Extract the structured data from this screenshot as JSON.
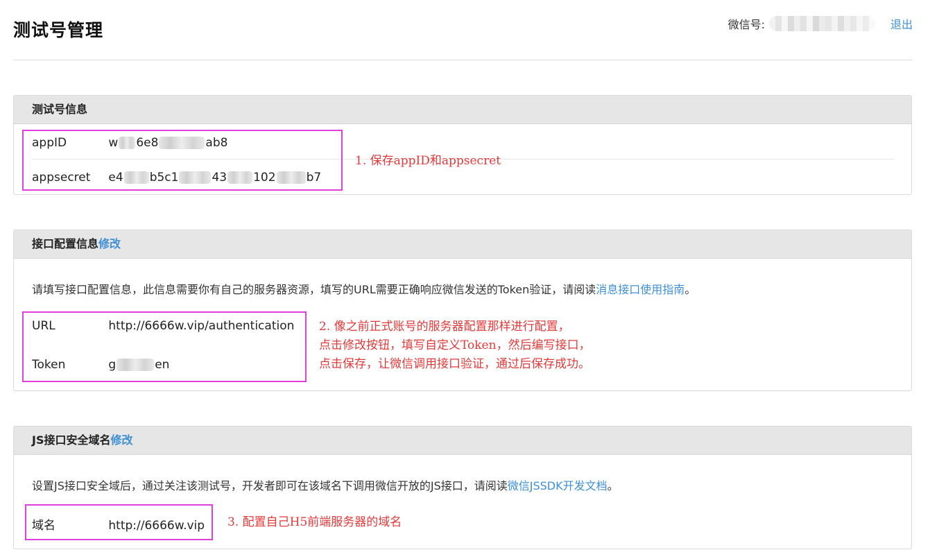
{
  "header": {
    "title": "测试号管理",
    "wechat_label": "微信号:",
    "logout": "退出"
  },
  "test_account": {
    "heading": "测试号信息",
    "appid_label": "appID",
    "appid_parts": [
      "w",
      "6e8",
      "ab8"
    ],
    "appsecret_label": "appsecret",
    "appsecret_parts": [
      "e4",
      "b5c1",
      "43",
      "102",
      "b7"
    ]
  },
  "interface_config": {
    "heading": "接口配置信息",
    "edit": "修改",
    "description": "请填写接口配置信息，此信息需要你有自己的服务器资源，填写的URL需要正确响应微信发送的Token验证，请阅读",
    "doc_link": "消息接口使用指南",
    "description_end": "。",
    "url_label": "URL",
    "url_value": "http://6666w.vip/authentication",
    "token_label": "Token",
    "token_parts": [
      "g",
      "en"
    ]
  },
  "js_domain": {
    "heading": "JS接口安全域名",
    "edit": "修改",
    "description": "设置JS接口安全域后，通过关注该测试号，开发者即可在该域名下调用微信开放的JS接口，请阅读",
    "doc_link": "微信JSSDK开发文档",
    "description_end": "。",
    "domain_label": "域名",
    "domain_value": "http://6666w.vip"
  },
  "annotations": {
    "note1": "1. 保存appID和appsecret",
    "note2_line1": "2. 像之前正式账号的服务器配置那样进行配置，",
    "note2_line2": "点击修改按钮，填写自定义Token，然后编写接口，",
    "note2_line3": "点击保存，让微信调用接口验证，通过后保存成功。",
    "note3": "3. 配置自己H5前端服务器的域名"
  },
  "colors": {
    "link": "#3d8fd6",
    "annotation_text": "#e23a3a",
    "annotation_box": "#e23fe0"
  }
}
